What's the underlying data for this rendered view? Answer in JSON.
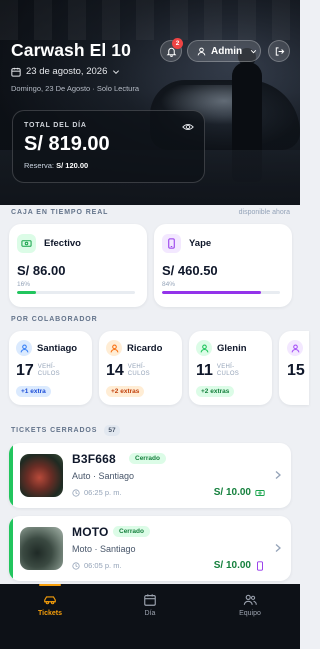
{
  "header": {
    "title": "Carwash El 10",
    "date": "23 de agosto, 2026",
    "subtitle": "Domingo, 23 De Agosto · Solo Lectura",
    "notification_count": "2",
    "user_label": "Admin"
  },
  "total_card": {
    "label": "TOTAL DEL DÍA",
    "amount": "S/ 819.00",
    "reserve_label": "Reserva:",
    "reserve_value": "S/ 120.00"
  },
  "cash_section": {
    "title": "CAJA EN TIEMPO REAL",
    "note": "disponible ahora",
    "cards": [
      {
        "label": "Efectivo",
        "amount": "S/ 86.00",
        "percent_text": "16%",
        "percent": 0.16,
        "color": "#22c55e",
        "icon": "cash-icon"
      },
      {
        "label": "Yape",
        "amount": "S/ 460.50",
        "percent_text": "84%",
        "percent": 0.84,
        "color": "#9333ea",
        "icon": "phone-icon"
      }
    ]
  },
  "collaborators": {
    "title": "POR COLABORADOR",
    "unit_line1": "VEHÍ-",
    "unit_line2": "CULOS",
    "items": [
      {
        "name": "Santiago",
        "count": "17",
        "extra": "+1 extra",
        "color": "#3b82f6"
      },
      {
        "name": "Ricardo",
        "count": "14",
        "extra": "+2 extras",
        "color": "#f97316"
      },
      {
        "name": "Glenin",
        "count": "11",
        "extra": "+2 extras",
        "color": "#22c55e"
      },
      {
        "count": "15",
        "color": "#a855f7"
      }
    ]
  },
  "tickets": {
    "title": "TICKETS CERRADOS",
    "count": "57",
    "items": [
      {
        "plate": "B3F668",
        "status": "Cerrado",
        "meta": "Auto · Santiago",
        "time": "06:25 p. m.",
        "price": "S/ 10.00",
        "payment_icon": "cash-icon"
      },
      {
        "plate": "MOTO",
        "status": "Cerrado",
        "meta": "Moto · Santiago",
        "time": "06:05 p. m.",
        "price": "S/ 10.00",
        "payment_icon": "phone-icon"
      }
    ]
  },
  "nav": {
    "items": [
      {
        "label": "Tickets",
        "icon": "car-icon",
        "active": true
      },
      {
        "label": "Día",
        "icon": "calendar-icon",
        "active": false
      },
      {
        "label": "Equipo",
        "icon": "team-icon",
        "active": false
      }
    ],
    "accent": "#f59e0b"
  }
}
